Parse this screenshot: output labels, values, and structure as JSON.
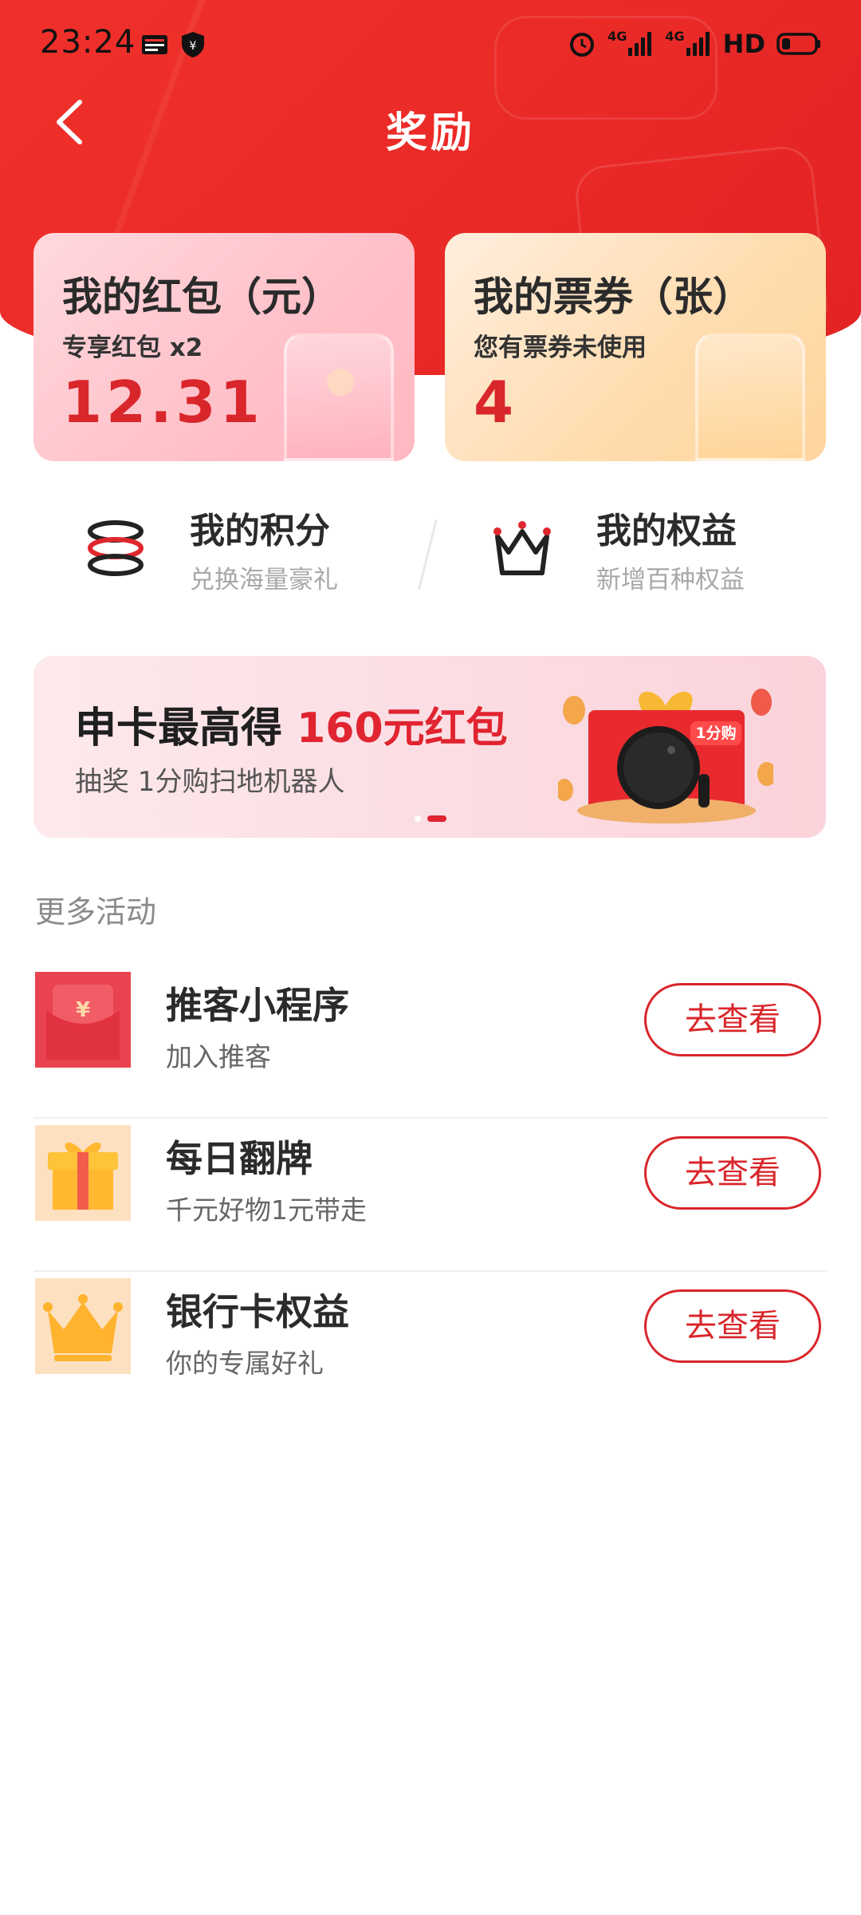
{
  "status_bar": {
    "time": "23:24",
    "icons": [
      "news-app-icon",
      "shield-icon",
      "alarm-icon",
      "signal-4g-icon",
      "signal-4g-icon",
      "hd-icon",
      "battery-icon"
    ],
    "network_1": "4G",
    "network_2": "4G",
    "hd": "HD"
  },
  "header": {
    "title": "奖励",
    "back_icon": "chevron-left-icon",
    "bg_color": "#ea2a27"
  },
  "cards": [
    {
      "title": "我的红包（元）",
      "subtitle": "专享红包 x2",
      "value": "12.31",
      "icon": "red-envelope-icon"
    },
    {
      "title": "我的票券（张）",
      "subtitle": "您有票券未使用",
      "value": "4",
      "icon": "ticket-icon"
    }
  ],
  "quick_links": [
    {
      "title": "我的积分",
      "subtitle": "兑换海量豪礼",
      "icon": "coins-stack-icon"
    },
    {
      "title": "我的权益",
      "subtitle": "新增百种权益",
      "icon": "crown-icon"
    }
  ],
  "banner": {
    "title_prefix": "申卡最高得 ",
    "title_highlight": "160元红包",
    "subtitle": "抽奖 1分购扫地机器人",
    "badge": "1分购",
    "page_count": 2,
    "active_page": 2
  },
  "more": {
    "section_title": "更多活动",
    "items": [
      {
        "title": "推客小程序",
        "subtitle": "加入推客",
        "button": "去查看",
        "icon": "red-envelope-yuan-icon"
      },
      {
        "title": "每日翻牌",
        "subtitle": "千元好物1元带走",
        "button": "去查看",
        "icon": "gift-box-icon"
      },
      {
        "title": "银行卡权益",
        "subtitle": "你的专属好礼",
        "button": "去查看",
        "icon": "crown-icon"
      }
    ]
  },
  "colors": {
    "accent": "#d9262b",
    "header": "#ea2a27",
    "muted": "#a8a8a8"
  }
}
